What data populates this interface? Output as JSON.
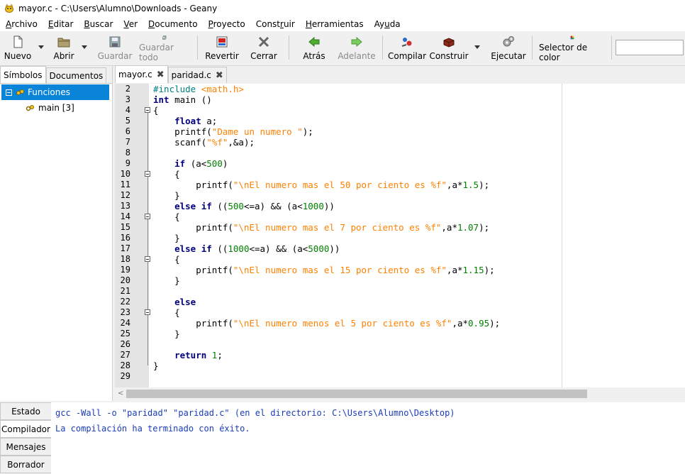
{
  "window": {
    "title": "mayor.c - C:\\Users\\Alumno\\Downloads - Geany"
  },
  "menu": [
    {
      "label": "Archivo",
      "u": "A",
      "rest": "rchivo"
    },
    {
      "label": "Editar",
      "u": "E",
      "rest": "ditar"
    },
    {
      "label": "Buscar",
      "u": "B",
      "rest": "uscar"
    },
    {
      "label": "Ver",
      "u": "V",
      "rest": "er"
    },
    {
      "label": "Documento",
      "u": "D",
      "rest": "ocumento"
    },
    {
      "label": "Proyecto",
      "u": "P",
      "rest": "royecto"
    },
    {
      "label": "Construir",
      "pre": "Const",
      "u": "r",
      "rest": "uir"
    },
    {
      "label": "Herramientas",
      "u": "H",
      "rest": "erramientas"
    },
    {
      "label": "Ayuda",
      "pre": "Ay",
      "u": "u",
      "rest": "da"
    }
  ],
  "toolbar": {
    "new": "Nuevo",
    "open": "Abrir",
    "save": "Guardar",
    "save_all": "Guardar todo",
    "revert": "Revertir",
    "close": "Cerrar",
    "back": "Atrás",
    "forward": "Adelante",
    "compile": "Compilar",
    "build": "Construir",
    "execute": "Ejecutar",
    "color_picker": "Selector de color"
  },
  "sidebar": {
    "tabs": [
      "Símbolos",
      "Documentos"
    ],
    "tree": {
      "group": "Funciones",
      "item": "main [3]"
    }
  },
  "editor": {
    "tabs": [
      {
        "label": "mayor.c"
      },
      {
        "label": "paridad.c"
      }
    ],
    "line_numbers": [
      "2",
      "3",
      "4",
      "5",
      "6",
      "7",
      "8",
      "9",
      "10",
      "11",
      "12",
      "13",
      "14",
      "15",
      "16",
      "17",
      "18",
      "19",
      "20",
      "21",
      "22",
      "23",
      "24",
      "25",
      "26",
      "27",
      "28",
      "29"
    ],
    "fold_lines": [
      4,
      10,
      14,
      18,
      23
    ]
  },
  "bottom": {
    "tabs": [
      "Estado",
      "Compilador",
      "Mensajes",
      "Borrador"
    ],
    "messages": [
      "gcc -Wall -o \"paridad\" \"paridad.c\" (en el directorio: C:\\Users\\Alumno\\Desktop)",
      "La compilación ha terminado con éxito."
    ]
  },
  "colors": {
    "keyword": "#00007f",
    "string": "#ff8000",
    "number": "#007f00",
    "preprocessor": "#007f7f",
    "selection": "#0a84d8"
  }
}
